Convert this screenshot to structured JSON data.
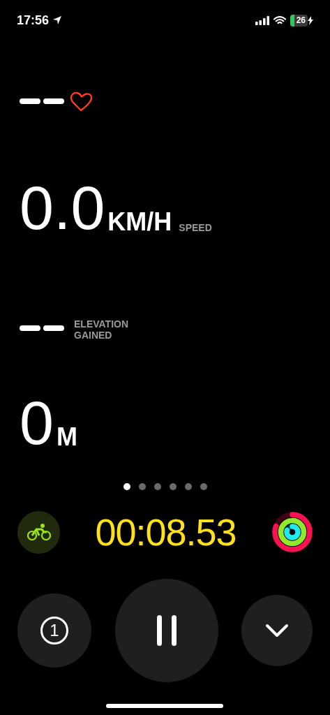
{
  "status_bar": {
    "time": "17:56",
    "battery": "26",
    "charging": true
  },
  "metrics": [
    {
      "kind": "heart"
    },
    {
      "kind": "value",
      "value": "0.0",
      "unit": "KM/H",
      "label": "SPEED"
    },
    {
      "kind": "empty",
      "label": "ELEVATION GAINED"
    },
    {
      "kind": "value",
      "value": "0",
      "unit": "M"
    }
  ],
  "pages": [
    {
      "selected": true
    },
    {
      "selected": false
    },
    {
      "selected": false
    },
    {
      "selected": false
    },
    {
      "selected": false
    },
    {
      "selected": false
    }
  ],
  "timer": "00:08.53",
  "rings": [
    {
      "color": "#fa114f"
    },
    {
      "color": "#92e82a"
    },
    {
      "color": "#1eeaef"
    }
  ],
  "buttons": [
    {
      "kind": "segment",
      "label": "1"
    },
    {
      "kind": "pause"
    },
    {
      "kind": "collapse"
    }
  ]
}
